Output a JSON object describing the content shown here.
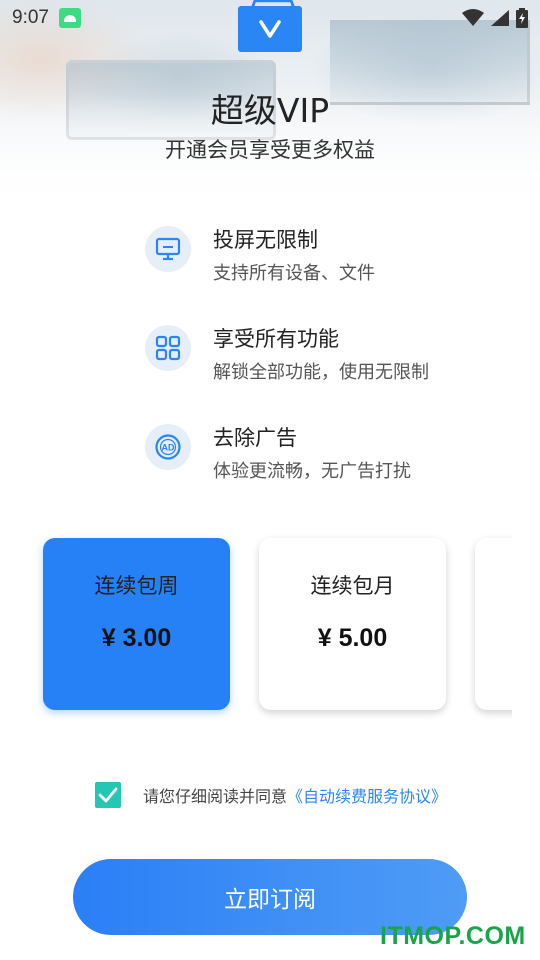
{
  "status_bar": {
    "time": "9:07"
  },
  "hero": {
    "title": "超级VIP",
    "subtitle": "开通会员享受更多权益"
  },
  "features": [
    {
      "icon": "monitor-icon",
      "title": "投屏无限制",
      "desc": "支持所有设备、文件"
    },
    {
      "icon": "grid-icon",
      "title": "享受所有功能",
      "desc": "解锁全部功能，使用无限制"
    },
    {
      "icon": "ad-icon",
      "title": "去除广告",
      "desc": "体验更流畅，无广告打扰"
    }
  ],
  "plans": [
    {
      "name": "连续包周",
      "price": "¥ 3.00",
      "selected": true
    },
    {
      "name": "连续包月",
      "price": "¥ 5.00",
      "selected": false
    }
  ],
  "agreement": {
    "checked": true,
    "text": "请您仔细阅读并同意",
    "link": "《自动续费服务协议》"
  },
  "subscribe_button": {
    "label": "立即订阅"
  },
  "watermark": "ITMOP.COM",
  "colors": {
    "accent": "#2681f7",
    "checkbox": "#26c6b5",
    "link": "#2b86f5",
    "watermark": "#1aa44a"
  }
}
